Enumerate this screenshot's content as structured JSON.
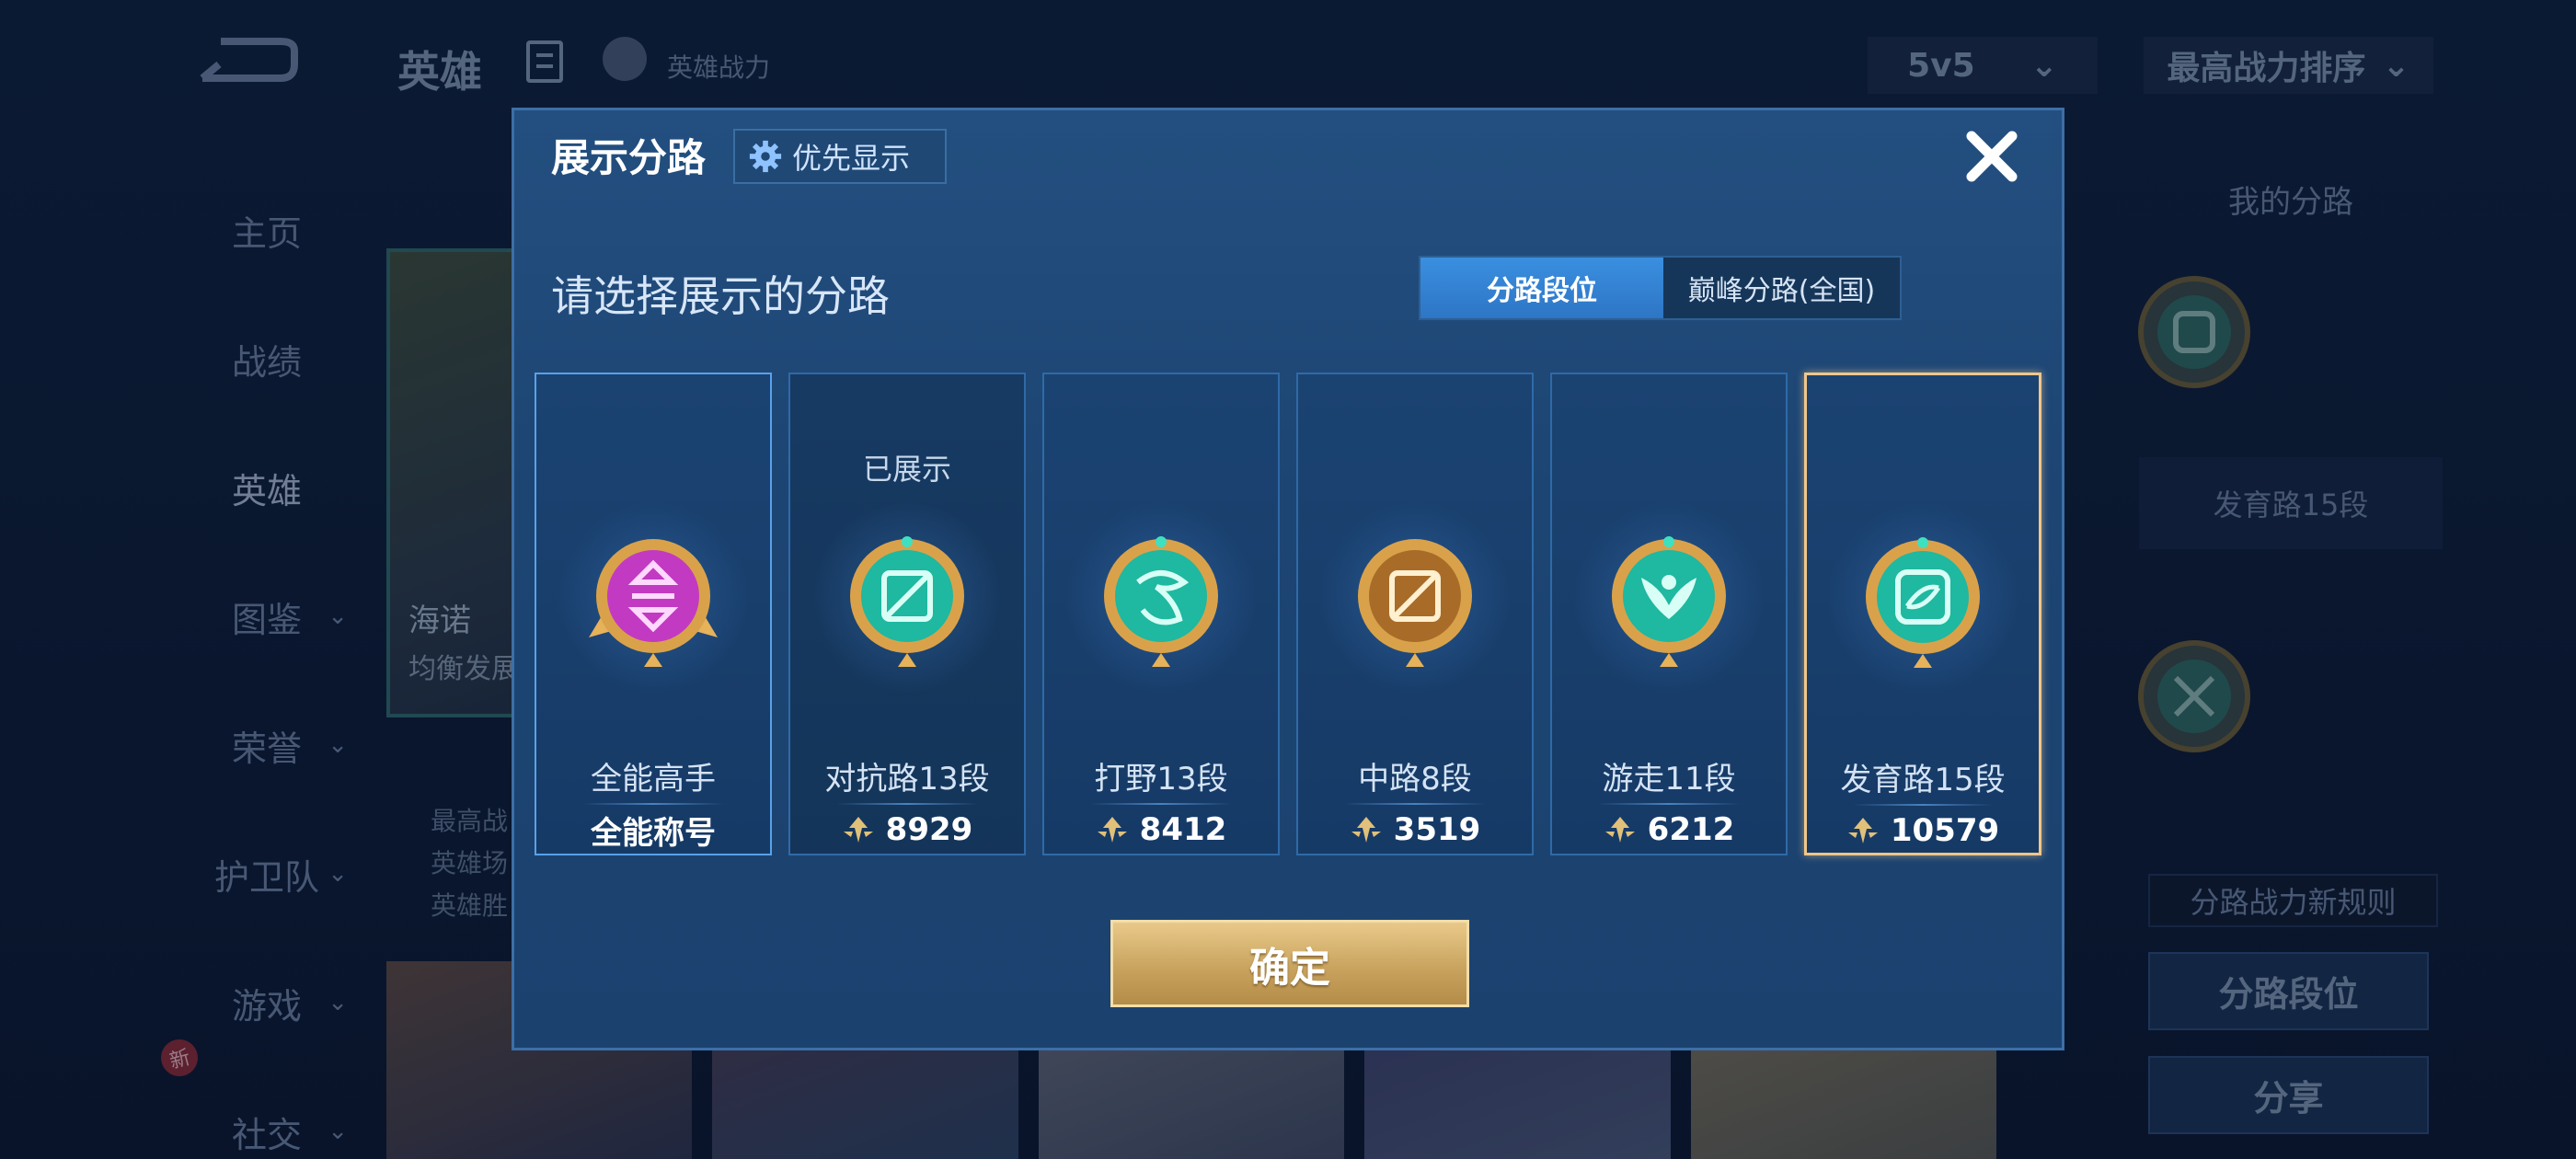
{
  "header": {
    "title": "英雄",
    "power_label": "英雄战力",
    "mode_select": "5v5",
    "sort_select": "最高战力排序"
  },
  "side_nav": [
    {
      "label": "主页",
      "has_arrow": false
    },
    {
      "label": "战绩",
      "has_arrow": false
    },
    {
      "label": "英雄",
      "has_arrow": false
    },
    {
      "label": "图鉴",
      "has_arrow": true
    },
    {
      "label": "荣誉",
      "has_arrow": true
    },
    {
      "label": "护卫队",
      "has_arrow": true
    },
    {
      "label": "游戏",
      "has_arrow": true
    },
    {
      "label": "社交",
      "has_arrow": true
    }
  ],
  "new_badge": "新",
  "hero_card": {
    "name": "海诺",
    "subtitle": "均衡发展",
    "stats": [
      "最高战",
      "英雄场",
      "英雄胜"
    ]
  },
  "right_panel": {
    "title": "我的分路",
    "current_lane": "发育路15段",
    "rule_label": "分路战力新规则",
    "lane_button": "分路段位",
    "share_button": "分享"
  },
  "modal": {
    "title": "展示分路",
    "priority_label": "优先显示",
    "subtitle": "请选择展示的分路",
    "tabs": [
      {
        "label": "分路段位",
        "active": true
      },
      {
        "label": "巅峰分路(全国)",
        "active": false
      }
    ],
    "displayed_tag": "已展示",
    "confirm_label": "确定",
    "cards": [
      {
        "name": "全能高手",
        "value": "全能称号",
        "icon": "all-round-badge-icon",
        "color": "#c23ac2",
        "is_title": true
      },
      {
        "name": "对抗路13段",
        "value": "8929",
        "icon": "clash-lane-badge-icon",
        "color": "#1fb8a0",
        "is_title": false,
        "displayed": true
      },
      {
        "name": "打野13段",
        "value": "8412",
        "icon": "jungle-badge-icon",
        "color": "#1fb8a0",
        "is_title": false
      },
      {
        "name": "中路8段",
        "value": "3519",
        "icon": "mid-lane-badge-icon",
        "color": "#d49a3a",
        "is_title": false
      },
      {
        "name": "游走11段",
        "value": "6212",
        "icon": "roam-badge-icon",
        "color": "#1fb8a0",
        "is_title": false
      },
      {
        "name": "发育路15段",
        "value": "10579",
        "icon": "farm-lane-badge-icon",
        "color": "#1fb8a0",
        "is_title": false,
        "selected": true
      }
    ]
  },
  "colors": {
    "accent_blue": "#3a8fe0",
    "gold": "#d8b06a",
    "teal": "#1fb8a0",
    "magenta": "#c23ac2",
    "selected_outline": "#f0c68a"
  }
}
